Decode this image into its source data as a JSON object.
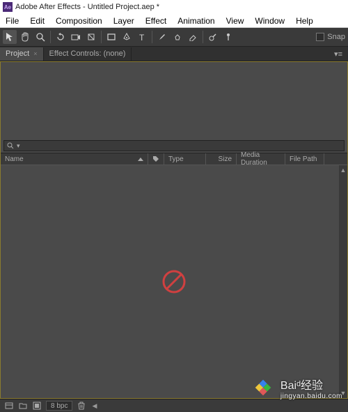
{
  "title": "Adobe After Effects - Untitled Project.aep *",
  "menu": {
    "file": "File",
    "edit": "Edit",
    "composition": "Composition",
    "layer": "Layer",
    "effect": "Effect",
    "animation": "Animation",
    "view": "View",
    "window": "Window",
    "help": "Help"
  },
  "toolbar": {
    "snap_label": "Snap"
  },
  "tabs": {
    "project": "Project",
    "effect_controls": "Effect Controls: (none)"
  },
  "columns": {
    "name": "Name",
    "type": "Type",
    "size": "Size",
    "media_duration": "Media Duration",
    "file_path": "File Path"
  },
  "search": {
    "placeholder": ""
  },
  "footer": {
    "bpc": "8 bpc"
  },
  "watermark": {
    "line1": "Baiᵈ经验",
    "line2": "jingyan.baidu.com"
  }
}
